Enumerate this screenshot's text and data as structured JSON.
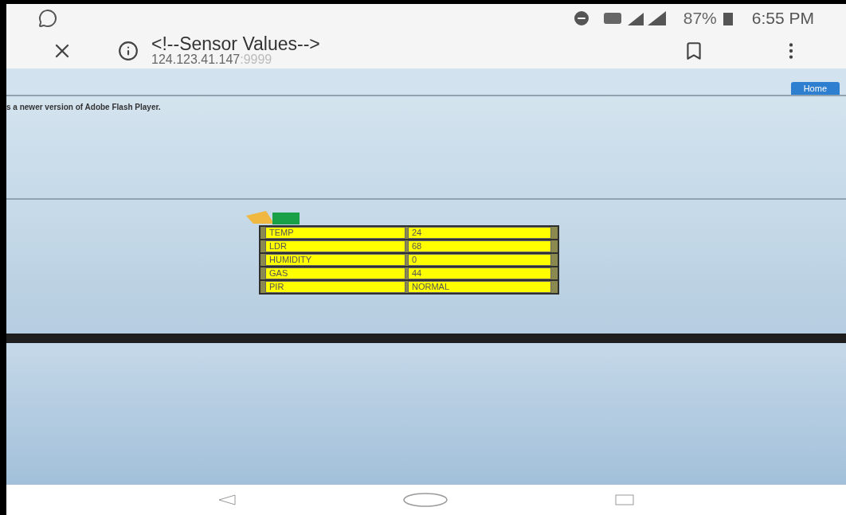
{
  "status_bar": {
    "battery": "87%",
    "time": "6:55 PM"
  },
  "toolbar": {
    "title": "<!--Sensor Values-->",
    "url_host": "124.123.41.147",
    "url_port": ":9999"
  },
  "page": {
    "nav_button": "Home",
    "flash_notice": "s a newer version of Adobe Flash Player.",
    "sensors": [
      {
        "name": "TEMP",
        "value": "24"
      },
      {
        "name": "LDR",
        "value": "68"
      },
      {
        "name": "HUMIDITY",
        "value": "0"
      },
      {
        "name": "GAS",
        "value": "44"
      },
      {
        "name": "PIR",
        "value": "NORMAL"
      }
    ]
  }
}
